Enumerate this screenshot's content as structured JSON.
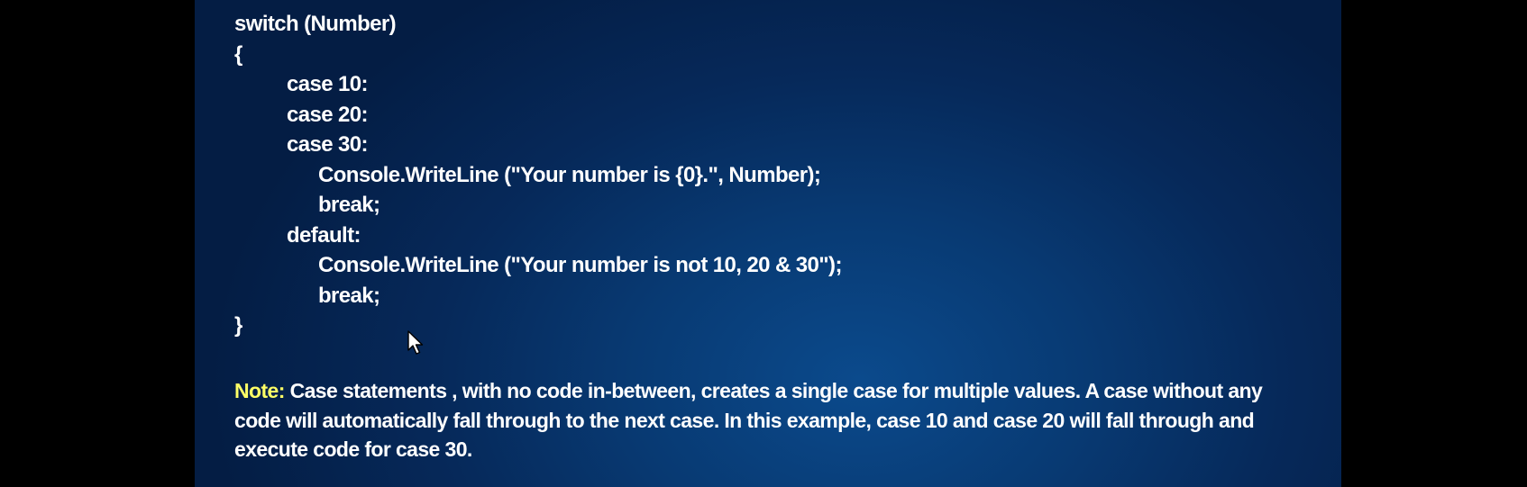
{
  "slide": {
    "code_lines": [
      "switch (Number)",
      "{",
      "case 10:",
      "case 20:",
      "case 30:",
      "Console.WriteLine (\"Your number is {0}.\", Number);",
      "break;",
      "default:",
      "Console.WriteLine (\"Your number is not 10, 20 & 30\");",
      "break;",
      "}"
    ],
    "note": {
      "label": "Note:",
      "text": " Case statements , with no code in-between, creates a single case for multiple values. A case without any code will automatically fall through to the next case. In this example, case 10 and case 20 will fall through and execute code for case 30."
    }
  },
  "colors": {
    "background": "#000000",
    "slide_bg": "#06295a",
    "text": "#ffffff",
    "note_label": "#ffff66"
  },
  "cursor": {
    "icon": "mouse-pointer-icon"
  }
}
